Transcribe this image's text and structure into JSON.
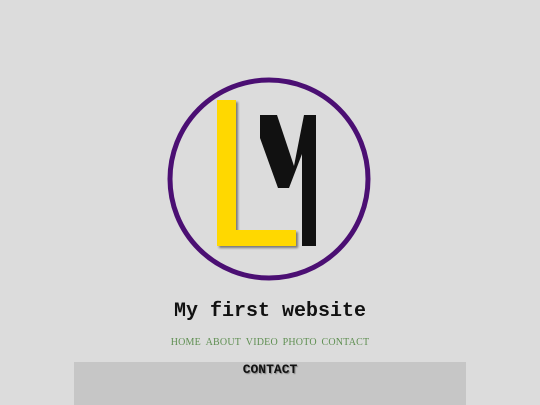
{
  "header": {
    "title": "My first website"
  },
  "logo": {
    "icon": "lm-monogram-logo",
    "letters": "LM",
    "colors": {
      "ring": "#4b0f73",
      "letter_l": "#ffd800",
      "letter_m": "#111111"
    }
  },
  "nav": {
    "items": [
      {
        "label": "HOME"
      },
      {
        "label": "ABOUT"
      },
      {
        "label": "VIDEO"
      },
      {
        "label": "PHOTO"
      },
      {
        "label": "CONTACT"
      }
    ],
    "color": "#5f8f52"
  },
  "section": {
    "title": "CONTACT"
  }
}
